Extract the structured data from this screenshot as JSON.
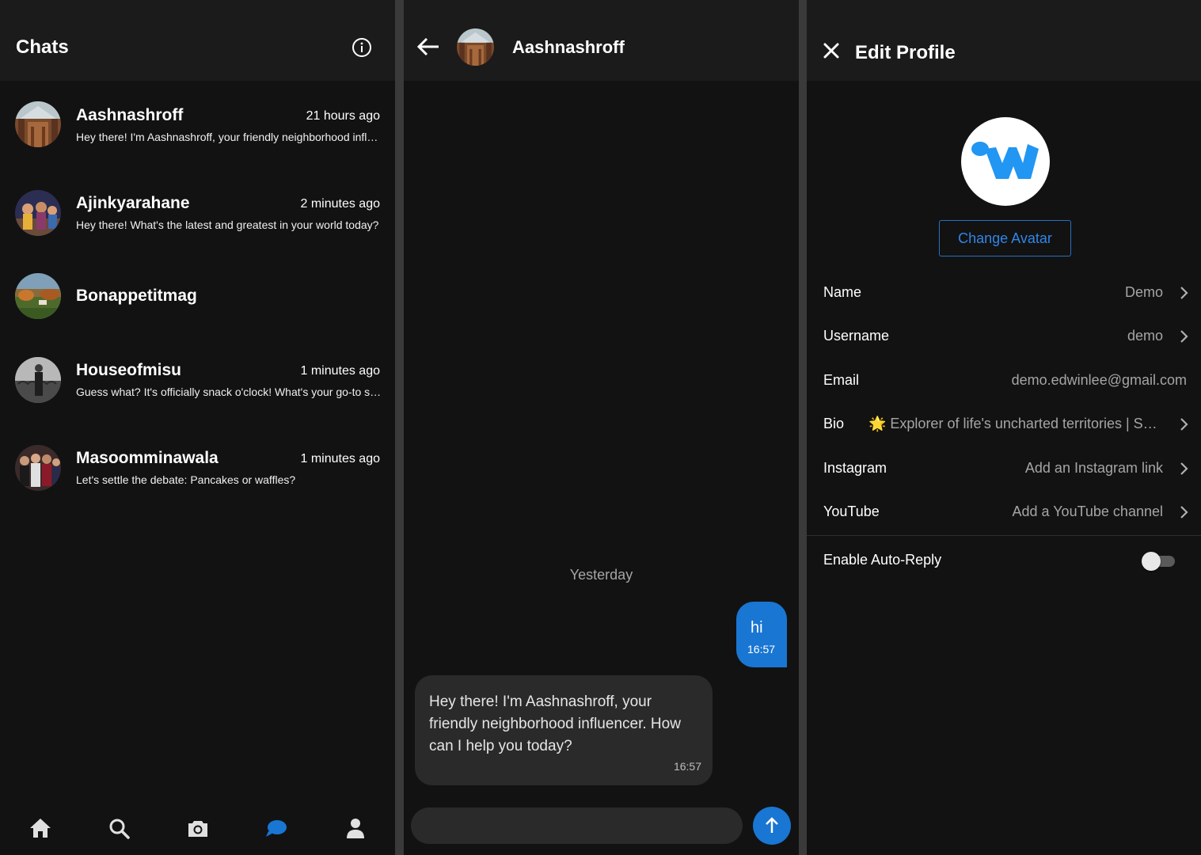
{
  "chats_panel": {
    "title": "Chats",
    "chats": [
      {
        "name": "Aashnashroff",
        "time": "21 hours ago",
        "preview": "Hey there! I'm Aashnashroff, your friendly neighborhood influencer. How can I help you today?"
      },
      {
        "name": "Ajinkyarahane",
        "time": "2 minutes ago",
        "preview": "Hey there! What's the latest and greatest in your world today?"
      },
      {
        "name": "Bonappetitmag",
        "time": "",
        "preview": ""
      },
      {
        "name": "Houseofmisu",
        "time": "1 minutes ago",
        "preview": "Guess what? It's officially snack o'clock! What's your go-to snack?"
      },
      {
        "name": "Masoomminawala",
        "time": "1 minutes ago",
        "preview": "Let's settle the debate: Pancakes or waffles?"
      }
    ],
    "nav": [
      "home-icon",
      "search-icon",
      "camera-icon",
      "chat-icon",
      "profile-icon"
    ],
    "active_nav": "chat-icon",
    "accent": "#1976d2"
  },
  "conversation": {
    "title": "Aashnashroff",
    "day_separator": "Yesterday",
    "messages": [
      {
        "direction": "outgoing",
        "text": "hi",
        "time": "16:57"
      },
      {
        "direction": "incoming",
        "text": "Hey there! I'm Aashnashroff, your friendly neighborhood influencer. How can I help you today?",
        "time": "16:57"
      }
    ],
    "input_placeholder": ""
  },
  "edit_profile": {
    "title": "Edit Profile",
    "change_avatar_label": "Change Avatar",
    "fields": [
      {
        "label": "Name",
        "value": "Demo",
        "has_arrow": true
      },
      {
        "label": "Username",
        "value": "demo",
        "has_arrow": true
      },
      {
        "label": "Email",
        "value": "demo.edwinlee@gmail.com",
        "has_arrow": false
      },
      {
        "label": "Bio",
        "value": "🌟 Explorer of life's uncharted territories | Seeker of adventures",
        "has_arrow": true
      },
      {
        "label": "Instagram",
        "value": "Add an Instagram link",
        "has_arrow": true
      },
      {
        "label": "YouTube",
        "value": "Add a YouTube channel",
        "has_arrow": true
      }
    ],
    "auto_reply_label": "Enable Auto-Reply",
    "auto_reply_enabled": false
  }
}
